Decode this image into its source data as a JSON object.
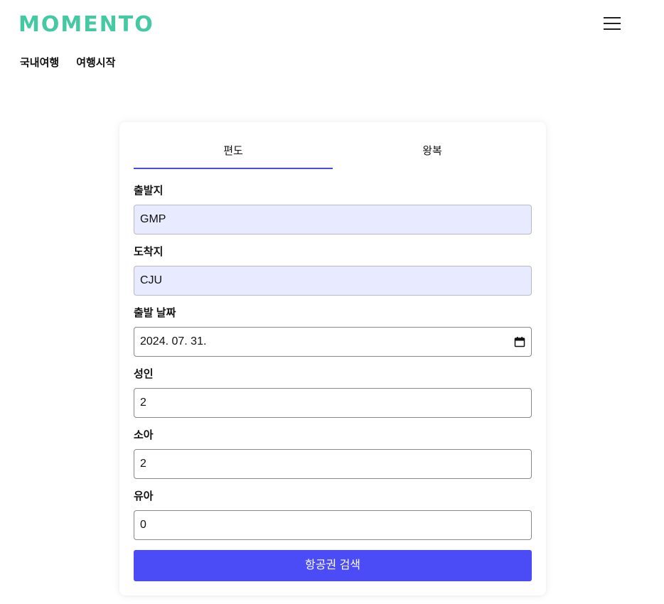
{
  "header": {
    "logo": "MOMENTO",
    "menu_icon": "hamburger-menu-icon"
  },
  "nav": {
    "items": [
      {
        "label": "국내여행"
      },
      {
        "label": "여행시작"
      }
    ]
  },
  "booking": {
    "tabs": [
      {
        "label": "편도",
        "active": true
      },
      {
        "label": "왕복",
        "active": false
      }
    ],
    "fields": {
      "departure": {
        "label": "출발지",
        "value": "GMP"
      },
      "arrival": {
        "label": "도착지",
        "value": "CJU"
      },
      "date": {
        "label": "출발 날짜",
        "value": "2024. 07. 31.",
        "icon": "calendar-icon"
      },
      "adult": {
        "label": "성인",
        "value": "2"
      },
      "child": {
        "label": "소아",
        "value": "2"
      },
      "infant": {
        "label": "유아",
        "value": "0"
      }
    },
    "search_label": "항공권 검색"
  },
  "colors": {
    "brand": "#44c9a3",
    "accent": "#4b4cf5",
    "autofill": "#e8ebff"
  }
}
